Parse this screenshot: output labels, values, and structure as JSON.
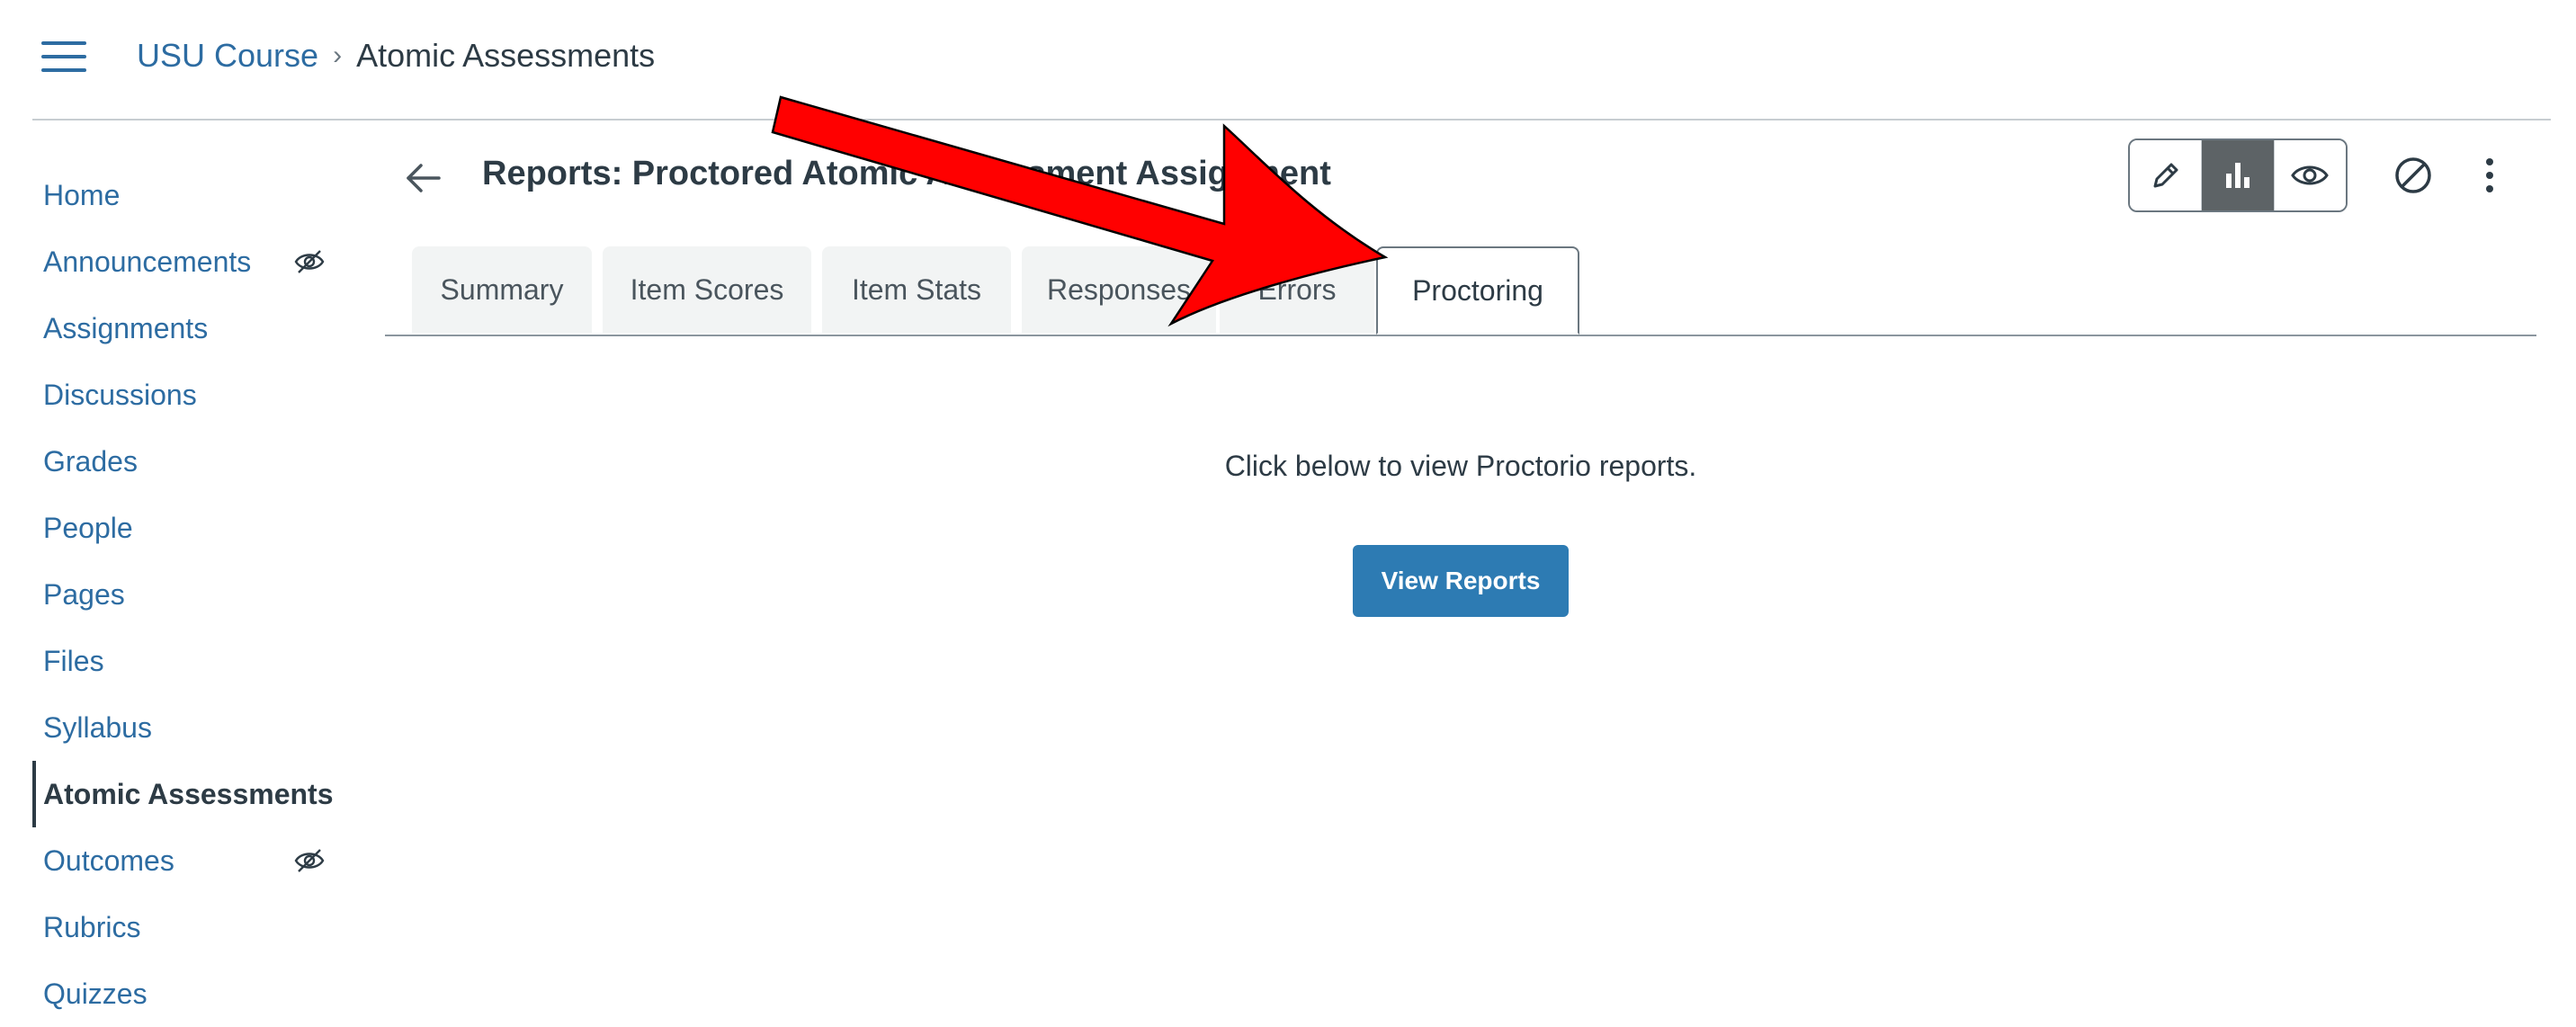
{
  "breadcrumb": {
    "course": "USU Course",
    "separator": "›",
    "current": "Atomic Assessments"
  },
  "sidebar": {
    "items": [
      {
        "label": "Home"
      },
      {
        "label": "Announcements",
        "hidden_from_students": true
      },
      {
        "label": "Assignments"
      },
      {
        "label": "Discussions"
      },
      {
        "label": "Grades"
      },
      {
        "label": "People"
      },
      {
        "label": "Pages"
      },
      {
        "label": "Files"
      },
      {
        "label": "Syllabus"
      },
      {
        "label": "Atomic Assessments",
        "active": true
      },
      {
        "label": "Outcomes",
        "hidden_from_students": true
      },
      {
        "label": "Rubrics"
      },
      {
        "label": "Quizzes"
      }
    ]
  },
  "header": {
    "title": "Reports: Proctored Atomic Assessment Assignment",
    "icons": [
      "arrow-left-icon",
      "pencil-icon",
      "bar-chart-icon",
      "eye-icon",
      "disable-icon",
      "kebab-icon"
    ],
    "active_view": "bar-chart-icon"
  },
  "tabs": [
    {
      "label": "Summary"
    },
    {
      "label": "Item Scores"
    },
    {
      "label": "Item Stats"
    },
    {
      "label": "Responses"
    },
    {
      "label": "Errors"
    },
    {
      "label": "Proctoring",
      "active": true
    }
  ],
  "proctoring": {
    "message": "Click below to view Proctorio reports.",
    "button_label": "View Reports"
  },
  "colors": {
    "link": "#2d6ca2",
    "text": "#2d3b45",
    "primary_button": "#2d7bb3",
    "active_toggle": "#5d6366",
    "annotation_arrow": "#ff0000"
  }
}
